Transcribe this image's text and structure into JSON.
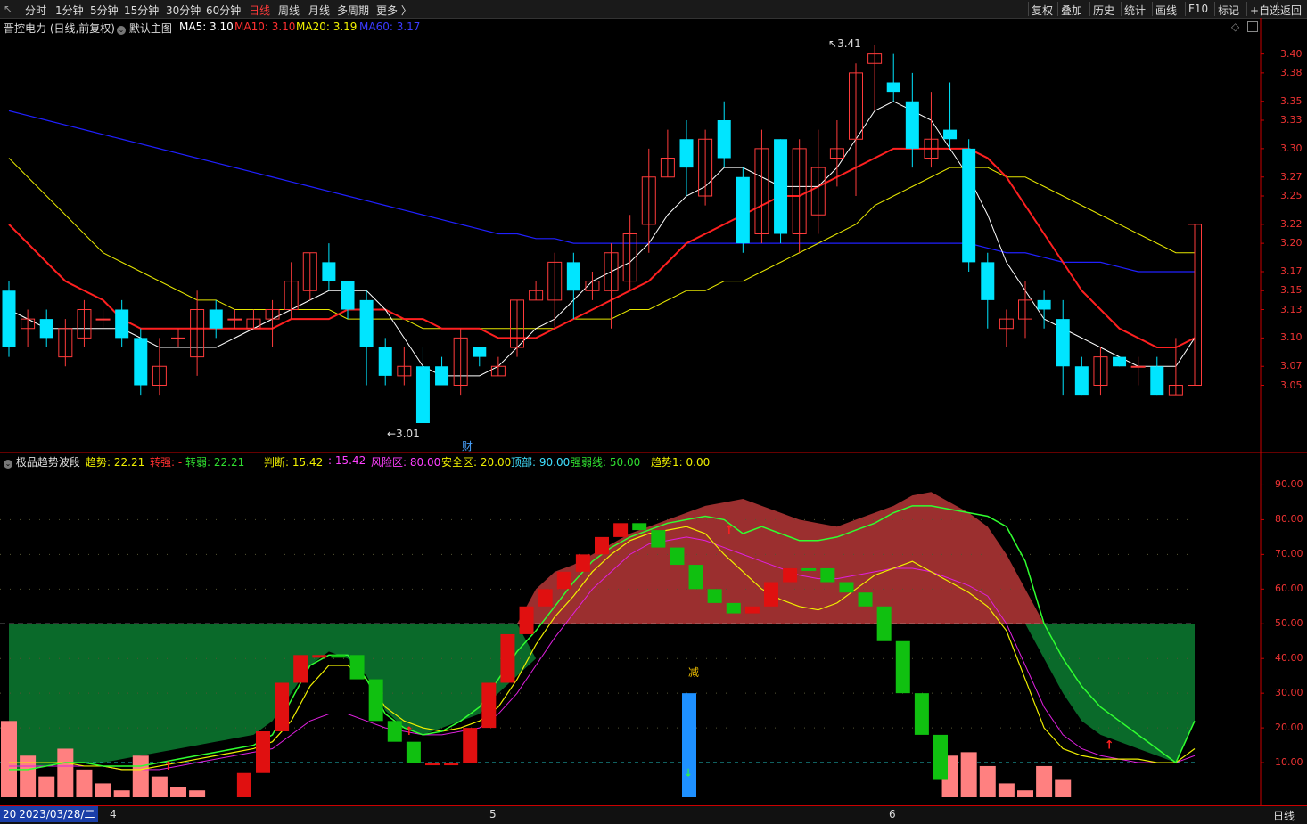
{
  "toolbar": {
    "back_icon": "back-arrow-icon",
    "periods": [
      "分时",
      "1分钟",
      "5分钟",
      "15分钟",
      "30分钟",
      "60分钟",
      "日线",
      "周线",
      "月线",
      "多周期",
      "更多 〉"
    ],
    "active_period": "日线",
    "right_buttons": [
      "复权",
      "叠加",
      "历史",
      "统计",
      "画线",
      "F10",
      "标记",
      "+自选",
      "返回"
    ]
  },
  "main_chart": {
    "title": "晋控电力 (日线,前复权)",
    "template": "默认主图",
    "ma5_label": "MA5: 3.10",
    "ma10_label": "MA10: 3.10",
    "ma20_label": "MA20: 3.19",
    "ma60_label": "MA60: 3.17",
    "high_label": "3.41",
    "low_label": "←3.01",
    "marker_cai": "财",
    "price_ticks": [
      "3.40",
      "3.38",
      "3.35",
      "3.33",
      "3.30",
      "3.27",
      "3.25",
      "3.22",
      "3.20",
      "3.17",
      "3.15",
      "3.13",
      "3.10",
      "3.07",
      "3.05"
    ]
  },
  "indicator": {
    "name": "极品趋势波段",
    "trend_label": "趋势: 22.21",
    "turn_strong_label": "转强: -",
    "turn_weak_label": "转弱: 22.21",
    "judge_label": "判断: 15.42",
    "judge2_label": ": 15.42",
    "risk_label": "风险区: 80.00",
    "safe_label": "安全区: 20.00",
    "top_label": "顶部: 90.00",
    "strong_weak_label": "强弱线: 50.00",
    "trend1_label": "趋势1: 0.00",
    "jian_label": "减",
    "ticks": [
      "90.00",
      "80.00",
      "70.00",
      "60.00",
      "50.00",
      "40.00",
      "30.00",
      "20.00",
      "10.00"
    ]
  },
  "bottom": {
    "date_label": "2023/03/28/二",
    "month_labels": [
      "4",
      "5",
      "6"
    ],
    "right_label": "日线"
  },
  "colors": {
    "up": "#ff3b3b",
    "down": "#00e5ff",
    "ma5": "#ffffff",
    "ma10": "#ff2020",
    "ma20": "#e6e600",
    "ma60": "#2020ff",
    "risk_fill": "#9b2f2f",
    "safe_fill": "#0a6a2a"
  },
  "chart_data": {
    "type": "candlestick",
    "price_range": [
      3.01,
      3.41
    ],
    "candles": [
      [
        3.15,
        3.09,
        3.16,
        3.08
      ],
      [
        3.11,
        3.12,
        3.13,
        3.09
      ],
      [
        3.12,
        3.1,
        3.13,
        3.09
      ],
      [
        3.08,
        3.11,
        3.12,
        3.07
      ],
      [
        3.1,
        3.13,
        3.14,
        3.09
      ],
      [
        3.12,
        3.12,
        3.13,
        3.11
      ],
      [
        3.13,
        3.1,
        3.14,
        3.09
      ],
      [
        3.1,
        3.05,
        3.11,
        3.04
      ],
      [
        3.05,
        3.07,
        3.1,
        3.04
      ],
      [
        3.1,
        3.1,
        3.11,
        3.09
      ],
      [
        3.08,
        3.13,
        3.15,
        3.06
      ],
      [
        3.13,
        3.11,
        3.14,
        3.1
      ],
      [
        3.12,
        3.12,
        3.13,
        3.11
      ],
      [
        3.11,
        3.12,
        3.13,
        3.11
      ],
      [
        3.12,
        3.13,
        3.14,
        3.09
      ],
      [
        3.13,
        3.16,
        3.18,
        3.12
      ],
      [
        3.15,
        3.19,
        3.19,
        3.14
      ],
      [
        3.18,
        3.16,
        3.2,
        3.15
      ],
      [
        3.16,
        3.13,
        3.16,
        3.12
      ],
      [
        3.14,
        3.09,
        3.15,
        3.05
      ],
      [
        3.09,
        3.06,
        3.1,
        3.05
      ],
      [
        3.06,
        3.07,
        3.09,
        3.05
      ],
      [
        3.07,
        3.01,
        3.09,
        3.01
      ],
      [
        3.07,
        3.05,
        3.08,
        3.05
      ],
      [
        3.05,
        3.1,
        3.11,
        3.04
      ],
      [
        3.09,
        3.08,
        3.09,
        3.07
      ],
      [
        3.06,
        3.07,
        3.08,
        3.06
      ],
      [
        3.09,
        3.14,
        3.14,
        3.08
      ],
      [
        3.14,
        3.15,
        3.16,
        3.14
      ],
      [
        3.14,
        3.18,
        3.19,
        3.11
      ],
      [
        3.18,
        3.15,
        3.19,
        3.12
      ],
      [
        3.15,
        3.16,
        3.17,
        3.14
      ],
      [
        3.15,
        3.19,
        3.2,
        3.11
      ],
      [
        3.16,
        3.21,
        3.23,
        3.15
      ],
      [
        3.22,
        3.27,
        3.3,
        3.19
      ],
      [
        3.27,
        3.29,
        3.32,
        3.27
      ],
      [
        3.31,
        3.28,
        3.33,
        3.25
      ],
      [
        3.25,
        3.31,
        3.32,
        3.24
      ],
      [
        3.33,
        3.29,
        3.35,
        3.28
      ],
      [
        3.27,
        3.2,
        3.28,
        3.19
      ],
      [
        3.21,
        3.3,
        3.32,
        3.2
      ],
      [
        3.31,
        3.21,
        3.31,
        3.2
      ],
      [
        3.21,
        3.3,
        3.31,
        3.19
      ],
      [
        3.23,
        3.28,
        3.32,
        3.21
      ],
      [
        3.29,
        3.3,
        3.33,
        3.26
      ],
      [
        3.31,
        3.38,
        3.39,
        3.25
      ],
      [
        3.39,
        3.4,
        3.41,
        3.34
      ],
      [
        3.37,
        3.36,
        3.4,
        3.35
      ],
      [
        3.35,
        3.3,
        3.38,
        3.28
      ],
      [
        3.29,
        3.31,
        3.36,
        3.28
      ],
      [
        3.32,
        3.31,
        3.37,
        3.3
      ],
      [
        3.3,
        3.18,
        3.31,
        3.17
      ],
      [
        3.18,
        3.14,
        3.19,
        3.11
      ],
      [
        3.11,
        3.12,
        3.13,
        3.09
      ],
      [
        3.12,
        3.14,
        3.16,
        3.1
      ],
      [
        3.14,
        3.13,
        3.15,
        3.11
      ],
      [
        3.12,
        3.07,
        3.14,
        3.04
      ],
      [
        3.07,
        3.04,
        3.08,
        3.04
      ],
      [
        3.05,
        3.08,
        3.09,
        3.04
      ],
      [
        3.08,
        3.07,
        3.08,
        3.07
      ],
      [
        3.07,
        3.07,
        3.08,
        3.05
      ],
      [
        3.07,
        3.04,
        3.08,
        3.04
      ],
      [
        3.04,
        3.05,
        3.1,
        3.04
      ],
      [
        3.05,
        3.22,
        3.22,
        3.05
      ]
    ],
    "ma5": [
      3.13,
      3.12,
      3.11,
      3.11,
      3.11,
      3.11,
      3.11,
      3.1,
      3.09,
      3.09,
      3.09,
      3.09,
      3.1,
      3.11,
      3.12,
      3.13,
      3.14,
      3.15,
      3.15,
      3.15,
      3.13,
      3.1,
      3.07,
      3.06,
      3.06,
      3.06,
      3.07,
      3.09,
      3.11,
      3.12,
      3.14,
      3.16,
      3.17,
      3.18,
      3.2,
      3.23,
      3.25,
      3.26,
      3.28,
      3.28,
      3.27,
      3.26,
      3.26,
      3.26,
      3.28,
      3.31,
      3.34,
      3.35,
      3.34,
      3.33,
      3.3,
      3.27,
      3.23,
      3.18,
      3.15,
      3.12,
      3.11,
      3.1,
      3.09,
      3.08,
      3.07,
      3.07,
      3.07,
      3.1
    ],
    "ma10": [
      3.22,
      3.2,
      3.18,
      3.16,
      3.15,
      3.14,
      3.12,
      3.11,
      3.11,
      3.11,
      3.11,
      3.11,
      3.11,
      3.11,
      3.11,
      3.12,
      3.12,
      3.12,
      3.13,
      3.13,
      3.13,
      3.12,
      3.12,
      3.11,
      3.11,
      3.11,
      3.1,
      3.1,
      3.1,
      3.11,
      3.12,
      3.13,
      3.14,
      3.15,
      3.16,
      3.18,
      3.2,
      3.21,
      3.22,
      3.23,
      3.24,
      3.25,
      3.25,
      3.26,
      3.27,
      3.28,
      3.29,
      3.3,
      3.3,
      3.3,
      3.3,
      3.3,
      3.29,
      3.27,
      3.24,
      3.21,
      3.18,
      3.15,
      3.13,
      3.11,
      3.1,
      3.09,
      3.09,
      3.1
    ],
    "ma20": [
      3.29,
      3.27,
      3.25,
      3.23,
      3.21,
      3.19,
      3.18,
      3.17,
      3.16,
      3.15,
      3.14,
      3.14,
      3.13,
      3.13,
      3.13,
      3.13,
      3.13,
      3.13,
      3.12,
      3.12,
      3.12,
      3.12,
      3.11,
      3.11,
      3.11,
      3.11,
      3.11,
      3.11,
      3.11,
      3.11,
      3.12,
      3.12,
      3.12,
      3.13,
      3.13,
      3.14,
      3.15,
      3.15,
      3.16,
      3.16,
      3.17,
      3.18,
      3.19,
      3.2,
      3.21,
      3.22,
      3.24,
      3.25,
      3.26,
      3.27,
      3.28,
      3.28,
      3.28,
      3.27,
      3.27,
      3.26,
      3.25,
      3.24,
      3.23,
      3.22,
      3.21,
      3.2,
      3.19,
      3.19
    ],
    "ma60": [
      3.34,
      3.335,
      3.33,
      3.325,
      3.32,
      3.315,
      3.31,
      3.305,
      3.3,
      3.295,
      3.29,
      3.285,
      3.28,
      3.275,
      3.27,
      3.265,
      3.26,
      3.255,
      3.25,
      3.245,
      3.24,
      3.235,
      3.23,
      3.225,
      3.22,
      3.215,
      3.21,
      3.21,
      3.205,
      3.205,
      3.2,
      3.2,
      3.2,
      3.2,
      3.2,
      3.2,
      3.2,
      3.2,
      3.2,
      3.2,
      3.2,
      3.2,
      3.2,
      3.2,
      3.2,
      3.2,
      3.2,
      3.2,
      3.2,
      3.2,
      3.2,
      3.2,
      3.195,
      3.19,
      3.19,
      3.185,
      3.18,
      3.18,
      3.18,
      3.175,
      3.17,
      3.17,
      3.17,
      3.17
    ],
    "indicator": {
      "range": [
        0,
        95
      ],
      "upper_curve": [
        50,
        50,
        50,
        50,
        50,
        50,
        50,
        50,
        50,
        50,
        50,
        50,
        50,
        50,
        50,
        50,
        50,
        50,
        50,
        50,
        50,
        50,
        50,
        50,
        50,
        50,
        50,
        50,
        60,
        65,
        67,
        70,
        73,
        76,
        78,
        80,
        82,
        84,
        85,
        86,
        84,
        82,
        80,
        79,
        78,
        80,
        82,
        84,
        87,
        88,
        85,
        82,
        78,
        70,
        60,
        50,
        50,
        50,
        50,
        50,
        50,
        50,
        50,
        50
      ],
      "lower_curve": [
        50,
        50,
        50,
        50,
        50,
        50,
        50,
        50,
        50,
        50,
        50,
        50,
        50,
        50,
        50,
        50,
        50,
        50,
        50,
        50,
        50,
        50,
        50,
        50,
        50,
        50,
        50,
        50,
        50,
        50,
        50,
        50,
        50,
        50,
        50,
        50,
        50,
        50,
        50,
        50,
        50,
        50,
        50,
        50,
        50,
        50,
        50,
        50,
        50,
        50,
        50,
        50,
        50,
        50,
        50,
        50,
        50,
        50,
        50,
        50,
        50,
        50,
        50,
        50
      ],
      "safe_top": [
        50,
        50,
        50,
        50,
        50,
        50,
        50,
        50,
        50,
        50,
        50,
        50,
        50,
        50,
        50,
        50,
        50,
        50,
        50,
        50,
        50,
        50,
        50,
        50,
        50,
        50,
        50,
        50,
        0,
        0,
        0,
        0,
        0,
        0,
        0,
        0,
        0,
        0,
        0,
        0,
        0,
        0,
        0,
        0,
        0,
        0,
        0,
        0,
        0,
        0,
        0,
        0,
        0,
        0,
        0,
        50,
        50,
        50,
        50,
        50,
        50,
        50,
        50,
        50
      ],
      "safe_bottom": [
        8,
        8,
        9,
        10,
        10,
        10,
        11,
        12,
        13,
        14,
        15,
        16,
        17,
        18,
        22,
        30,
        38,
        42,
        40,
        35,
        25,
        20,
        18,
        20,
        22,
        24,
        30,
        35,
        40,
        45,
        50,
        50,
        50,
        50,
        50,
        50,
        50,
        50,
        50,
        50,
        50,
        50,
        50,
        50,
        50,
        50,
        50,
        50,
        50,
        50,
        50,
        50,
        50,
        50,
        50,
        40,
        30,
        22,
        18,
        16,
        14,
        12,
        10,
        22
      ],
      "trend_green": [
        8,
        8,
        9,
        10,
        10,
        9,
        9,
        9,
        10,
        11,
        12,
        13,
        14,
        15,
        18,
        28,
        38,
        41,
        41,
        34,
        24,
        20,
        18,
        19,
        22,
        26,
        34,
        42,
        48,
        55,
        62,
        68,
        72,
        75,
        77,
        79,
        80,
        81,
        80,
        76,
        78,
        76,
        74,
        74,
        75,
        77,
        79,
        82,
        84,
        84,
        83,
        82,
        81,
        78,
        68,
        50,
        40,
        32,
        26,
        22,
        18,
        14,
        10,
        22
      ],
      "trend_yellow": [
        10,
        10,
        10,
        10,
        9,
        9,
        8,
        8,
        9,
        10,
        11,
        12,
        13,
        14,
        16,
        22,
        32,
        38,
        38,
        34,
        26,
        22,
        20,
        19,
        20,
        22,
        26,
        34,
        44,
        52,
        58,
        65,
        70,
        74,
        76,
        77,
        78,
        76,
        70,
        65,
        60,
        57,
        55,
        54,
        56,
        60,
        64,
        66,
        68,
        65,
        62,
        59,
        55,
        48,
        34,
        20,
        14,
        12,
        11,
        11,
        11,
        10,
        10,
        14
      ],
      "trend_magenta": [
        9,
        9,
        9,
        9,
        9,
        9,
        8,
        8,
        8,
        9,
        10,
        11,
        12,
        13,
        14,
        18,
        22,
        24,
        24,
        22,
        20,
        19,
        18,
        18,
        19,
        20,
        24,
        30,
        38,
        46,
        53,
        60,
        65,
        70,
        73,
        74,
        75,
        74,
        72,
        70,
        68,
        66,
        64,
        63,
        63,
        64,
        65,
        66,
        66,
        65,
        63,
        61,
        58,
        50,
        38,
        26,
        18,
        14,
        12,
        11,
        10,
        10,
        10,
        12
      ],
      "bars": [
        [
          0,
          22,
          0
        ],
        [
          1,
          12,
          0
        ],
        [
          2,
          6,
          0
        ],
        [
          3,
          14,
          0
        ],
        [
          4,
          8,
          0
        ],
        [
          5,
          4,
          0
        ],
        [
          6,
          2,
          0
        ],
        [
          7,
          12,
          0
        ],
        [
          8,
          6,
          0
        ],
        [
          9,
          3,
          0
        ],
        [
          10,
          2,
          0
        ],
        [
          11,
          0,
          0
        ],
        [
          12,
          7,
          1
        ],
        [
          13,
          19,
          1
        ],
        [
          14,
          33,
          1
        ],
        [
          15,
          41,
          1
        ],
        [
          16,
          41,
          1
        ],
        [
          17,
          41,
          2
        ],
        [
          18,
          34,
          2
        ],
        [
          19,
          22,
          2
        ],
        [
          20,
          16,
          2
        ],
        [
          21,
          10,
          2
        ],
        [
          22,
          10,
          1
        ],
        [
          23,
          10,
          1
        ],
        [
          24,
          20,
          1
        ],
        [
          25,
          33,
          1
        ],
        [
          26,
          47,
          1
        ],
        [
          27,
          55,
          1
        ],
        [
          28,
          60,
          1
        ],
        [
          29,
          65,
          1
        ],
        [
          30,
          70,
          1
        ],
        [
          31,
          75,
          1
        ],
        [
          32,
          79,
          1
        ],
        [
          33,
          77,
          2
        ],
        [
          34,
          72,
          2
        ],
        [
          35,
          67,
          2
        ],
        [
          36,
          60,
          2
        ],
        [
          37,
          56,
          2
        ],
        [
          38,
          53,
          2
        ],
        [
          39,
          55,
          1
        ],
        [
          40,
          62,
          1
        ],
        [
          41,
          66,
          1
        ],
        [
          42,
          66,
          2
        ],
        [
          43,
          62,
          2
        ],
        [
          44,
          59,
          2
        ],
        [
          45,
          55,
          2
        ],
        [
          46,
          45,
          2
        ],
        [
          47,
          30,
          2
        ],
        [
          48,
          18,
          2
        ],
        [
          49,
          5,
          2
        ],
        [
          50,
          12,
          0
        ],
        [
          51,
          13,
          0
        ],
        [
          52,
          9,
          0
        ],
        [
          53,
          4,
          0
        ],
        [
          54,
          2,
          0
        ],
        [
          55,
          9,
          0
        ],
        [
          56,
          5,
          0
        ]
      ]
    }
  }
}
